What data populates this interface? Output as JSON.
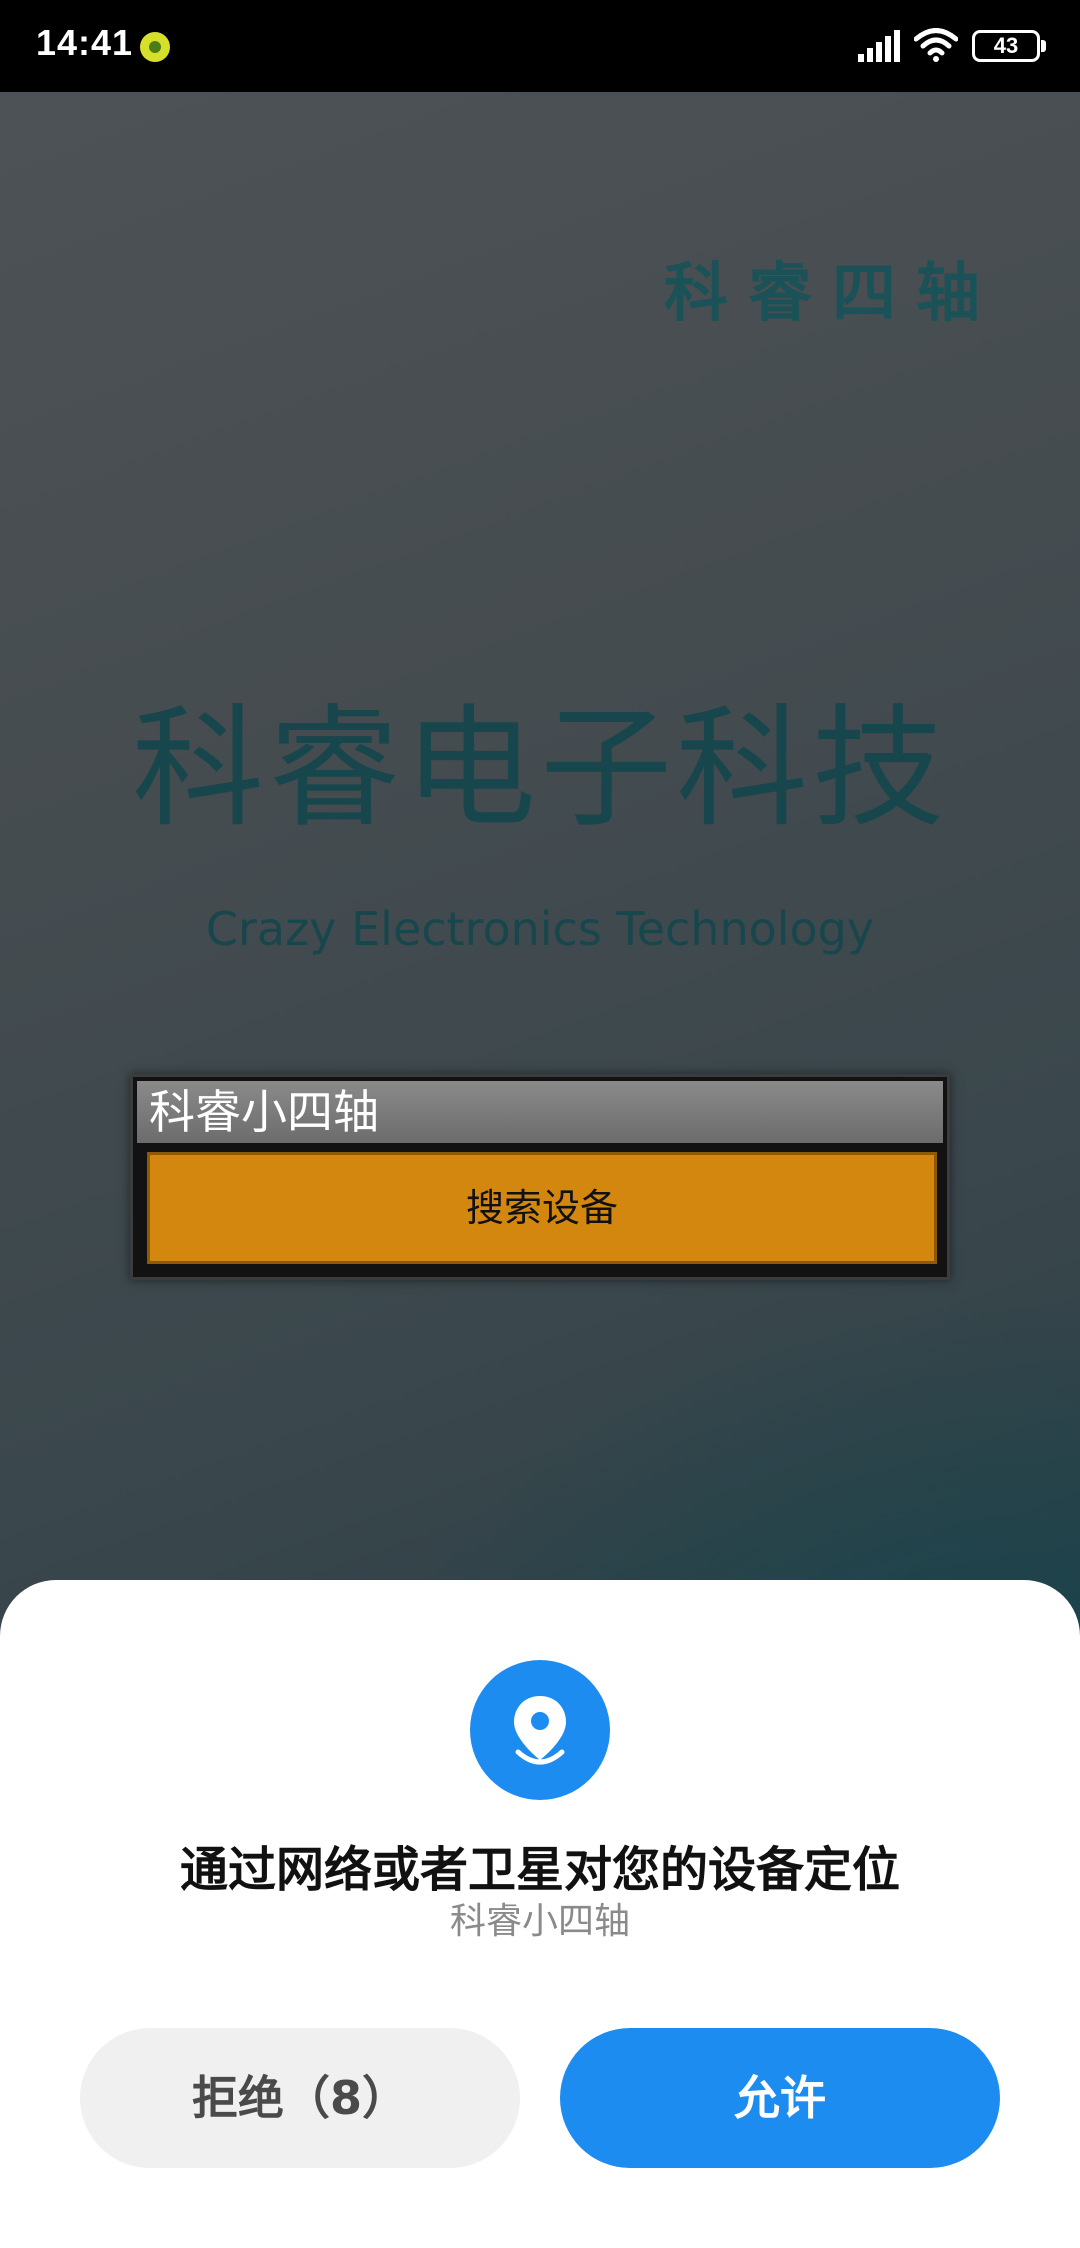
{
  "status_bar": {
    "time": "14:41",
    "battery": "43",
    "app_icon": "app-notification-icon",
    "signal_icon": "signal-icon",
    "wifi_icon": "wifi-icon"
  },
  "app": {
    "brand_top": "科睿四轴",
    "title_cn": "科睿电子科技",
    "title_en": "Crazy Electronics Technology",
    "device_name": "科睿小四轴",
    "search_button_label": "搜索设备"
  },
  "dialog": {
    "icon": "location-pin-icon",
    "title": "通过网络或者卫星对您的设备定位",
    "subtitle": "科睿小四轴",
    "deny_label": "拒绝（8）",
    "allow_label": "允许"
  },
  "colors": {
    "accent_blue": "#1d8cf0",
    "search_orange": "#d4870f",
    "title_teal": "#17464c"
  }
}
